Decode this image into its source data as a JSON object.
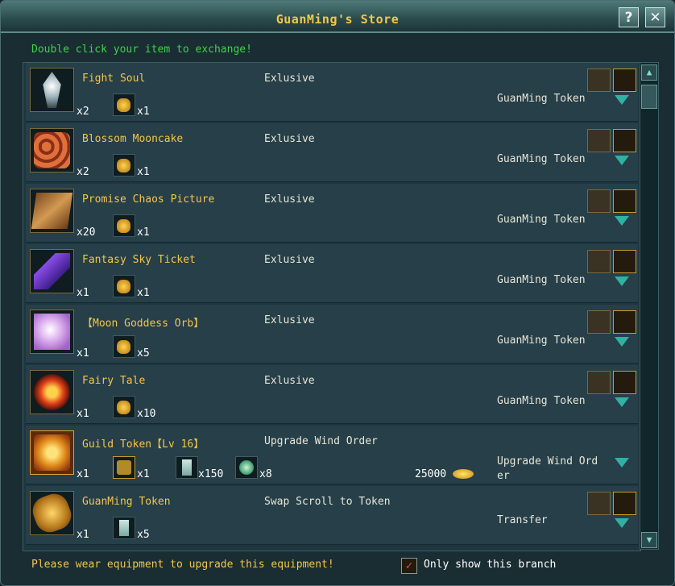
{
  "window": {
    "title": "GuanMing's Store",
    "help_label": "?",
    "close_label": "✕"
  },
  "hint": "Double click your item to exchange!",
  "items": [
    {
      "name": "Fight Soul",
      "category": "Exlusive",
      "qty": "x2",
      "cost_qty": "x1",
      "currency": "GuanMing Token",
      "icon": "fight-soul-icon",
      "color": "#cfd8dc"
    },
    {
      "name": "Blossom Mooncake",
      "category": "Exlusive",
      "qty": "x2",
      "cost_qty": "x1",
      "currency": "GuanMing Token",
      "icon": "mooncake-icon",
      "color": "#c1502e"
    },
    {
      "name": "Promise Chaos Picture",
      "category": "Exlusive",
      "qty": "x20",
      "cost_qty": "x1",
      "currency": "GuanMing Token",
      "icon": "picture-scroll-icon",
      "color": "#c08a3e"
    },
    {
      "name": "Fantasy Sky Ticket",
      "category": "Exlusive",
      "qty": "x1",
      "cost_qty": "x1",
      "currency": "GuanMing Token",
      "icon": "ticket-scroll-icon",
      "color": "#6b3fc7"
    },
    {
      "name": "【Moon Goddess Orb】",
      "category": "Exlusive",
      "qty": "x1",
      "cost_qty": "x5",
      "currency": "GuanMing Token",
      "icon": "orb-icon",
      "color": "#d8a6e8"
    },
    {
      "name": "Fairy Tale",
      "category": "Exlusive",
      "qty": "x1",
      "cost_qty": "x10",
      "currency": "GuanMing Token",
      "icon": "fairy-tale-icon",
      "color": "#d8421a"
    }
  ],
  "guild": {
    "name": "Guild Token【Lv 16】",
    "category": "Upgrade Wind Order",
    "qty": "x1",
    "costs": [
      "x1",
      "x150",
      "x8"
    ],
    "gold": "25000",
    "currency": "Upgrade Wind Ord er"
  },
  "guanming": {
    "name": "GuanMing Token",
    "category": "Swap Scroll to Token",
    "qty": "x1",
    "cost_qty": "x5",
    "currency": "Transfer"
  },
  "footer": {
    "warning": "Please wear equipment to upgrade this equipment!",
    "checkbox_label": "Only show this branch",
    "checkbox_mark": "✓",
    "checked": true
  },
  "colors": {
    "gold_text": "#f3c64a",
    "hint_green": "#3ed24a",
    "arrow_teal": "#2fb1a4"
  }
}
